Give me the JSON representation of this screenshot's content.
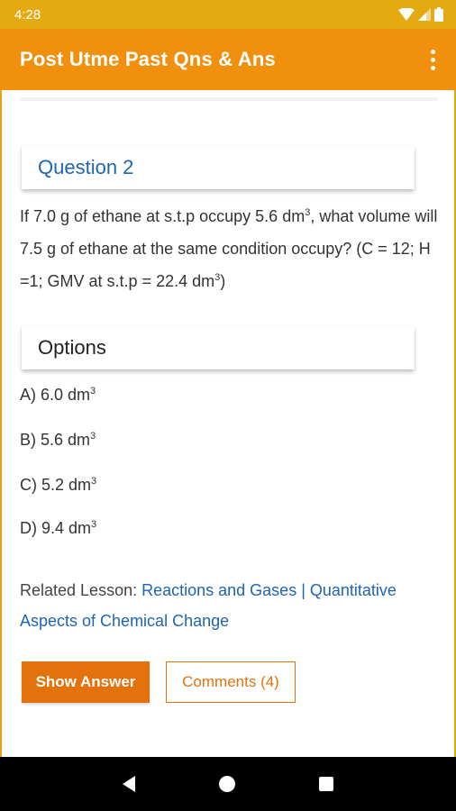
{
  "status_bar": {
    "time": "4:28",
    "icons": [
      "wifi-icon",
      "signal-icon",
      "battery-icon"
    ]
  },
  "app_bar": {
    "title": "Post Utme Past Qns & Ans",
    "menu_icon": "more-vert-icon"
  },
  "question": {
    "heading": "Question 2",
    "text_part1": "If 7.0 g of ethane at s.t.p occupy 5.6 dm",
    "text_sup1": "3",
    "text_part2": ", what volume will 7.5 g of ethane at the same condition occupy? (C = 12; H =1; GMV at s.t.p = 22.4 dm",
    "text_sup2": "3",
    "text_part3": ")"
  },
  "options": {
    "heading": "Options",
    "items": [
      {
        "text": "A) 6.0 dm",
        "sup": "3"
      },
      {
        "text": "B) 5.6 dm",
        "sup": "3"
      },
      {
        "text": "C) 5.2 dm",
        "sup": "3"
      },
      {
        "text": "D) 9.4 dm",
        "sup": "3"
      }
    ]
  },
  "related": {
    "label": "Related Lesson: ",
    "link1": "Reactions and Gases",
    "separator": " | ",
    "link2": "Quantitative Aspects of Chemical Change"
  },
  "buttons": {
    "show_answer": "Show Answer",
    "comments": "Comments (4)"
  },
  "colors": {
    "app_bar": "#f0900c",
    "status_bar": "#e5a912",
    "accent_button": "#e4720c",
    "link": "#1e64b4"
  }
}
